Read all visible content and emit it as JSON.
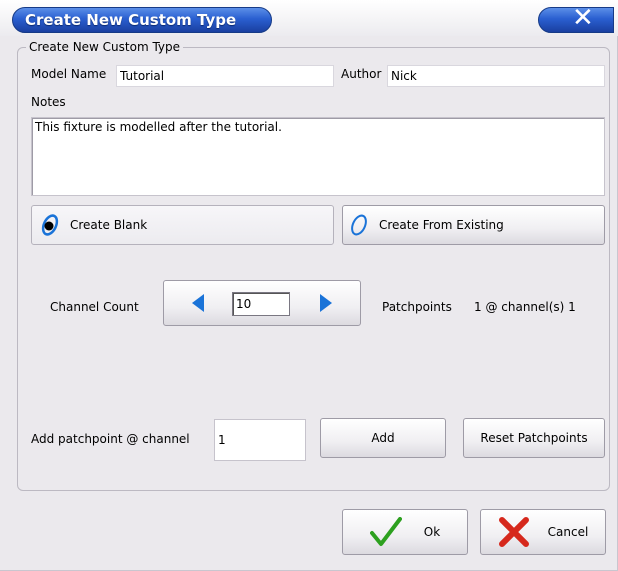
{
  "window": {
    "title": "Create New Custom Type",
    "close_icon": "close-icon"
  },
  "group": {
    "title": "Create New Custom Type"
  },
  "model_name": {
    "label": "Model Name",
    "value": "Tutorial"
  },
  "author": {
    "label": "Author",
    "value": "Nick"
  },
  "notes": {
    "label": "Notes",
    "value": "This fixture is modelled after the tutorial."
  },
  "mode": {
    "create_blank": "Create Blank",
    "create_from_existing": "Create From Existing",
    "selected": "Create Blank"
  },
  "channel_count": {
    "label": "Channel Count",
    "value": "10"
  },
  "patchpoints": {
    "label": "Patchpoints",
    "value": "1 @ channel(s) 1"
  },
  "add_patchpoint": {
    "label": "Add patchpoint @ channel",
    "value": "1",
    "add_button": "Add",
    "reset_button": "Reset Patchpoints"
  },
  "footer": {
    "ok": "Ok",
    "cancel": "Cancel"
  },
  "colors": {
    "title_blue": "#2a5fd0",
    "ok_green": "#2da01f",
    "cancel_red": "#d6281c",
    "spin_arrow_blue": "#1a73d8"
  }
}
